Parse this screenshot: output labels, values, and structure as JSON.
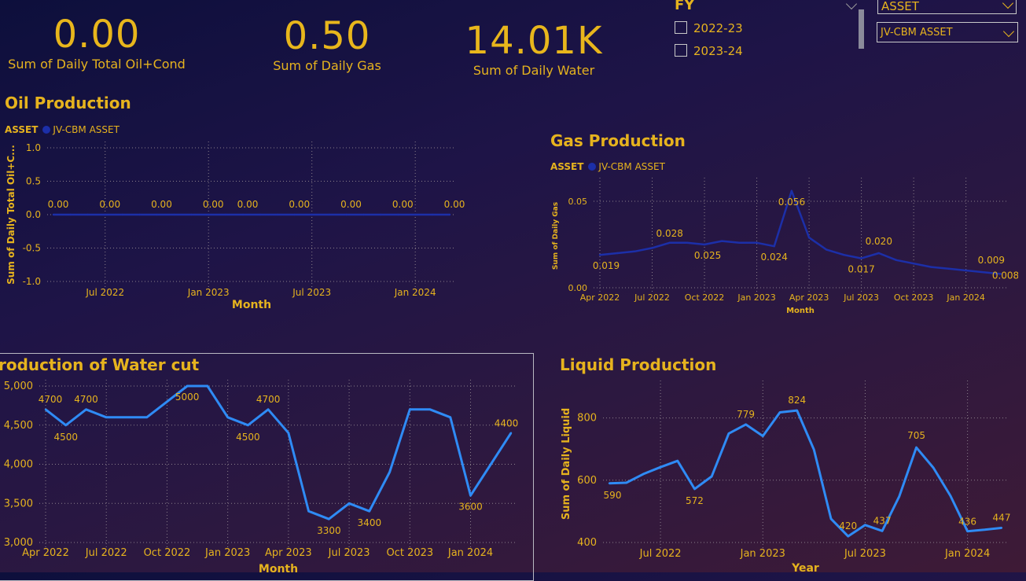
{
  "kpis": [
    {
      "value": "0.00",
      "label": "Sum of Daily Total Oil+Cond"
    },
    {
      "value": "0.50",
      "label": "Sum of Daily Gas"
    },
    {
      "value": "14.01K",
      "label": "Sum of Daily Water"
    }
  ],
  "fy_filter": {
    "title": "FY",
    "items": [
      "2022-23",
      "2023-24"
    ]
  },
  "asset_filter": {
    "header": "ASSET",
    "selected": "JV-CBM ASSET"
  },
  "colors": {
    "accent": "#e6b31e",
    "dark_series": "#1c2fa8",
    "bright_series": "#2f8bf5"
  },
  "charts": {
    "oil": {
      "title": "Oil Production",
      "legend_title": "ASSET",
      "legend_item": "JV-CBM ASSET"
    },
    "gas": {
      "title": "Gas Production",
      "legend_title": "ASSET",
      "legend_item": "JV-CBM ASSET"
    },
    "water": {
      "title": "roduction of Water cut"
    },
    "liquid": {
      "title": "Liquid Production"
    }
  },
  "chart_data": [
    {
      "id": "oil",
      "type": "line",
      "title": "Oil Production",
      "xlabel": "Month",
      "ylabel": "Sum of Daily Total Oil+C...",
      "legend": "top-left",
      "grid": true,
      "ylim": [
        -1.0,
        1.0
      ],
      "yticks": [
        "1.0",
        "0.5",
        "0.0",
        "-0.5",
        "-1.0"
      ],
      "xticks": [
        "Jul 2022",
        "Jan 2023",
        "Jul 2023",
        "Jan 2024"
      ],
      "series": [
        {
          "name": "JV-CBM ASSET",
          "values": [
            0,
            0,
            0,
            0,
            0,
            0,
            0,
            0,
            0,
            0,
            0,
            0,
            0,
            0,
            0,
            0,
            0,
            0,
            0,
            0,
            0,
            0,
            0,
            0
          ]
        }
      ],
      "data_labels": [
        "0.00",
        "0.00",
        "0.00",
        "0.00",
        "0.00",
        "0.00",
        "0.00",
        "0.00",
        "0.00"
      ]
    },
    {
      "id": "gas",
      "type": "line",
      "title": "Gas Production",
      "xlabel": "Month",
      "ylabel": "Sum of Daily Gas",
      "legend": "top-left",
      "grid": true,
      "ylim": [
        0,
        0.06
      ],
      "yticks": [
        "0.05",
        "0.00"
      ],
      "xticks": [
        "Apr 2022",
        "Jul 2022",
        "Oct 2022",
        "Jan 2023",
        "Apr 2023",
        "Jul 2023",
        "Oct 2023",
        "Jan 2024"
      ],
      "series": [
        {
          "name": "JV-CBM ASSET",
          "values": [
            0.019,
            0.02,
            0.021,
            0.023,
            0.026,
            0.026,
            0.025,
            0.027,
            0.026,
            0.026,
            0.024,
            0.056,
            0.029,
            0.022,
            0.019,
            0.017,
            0.02,
            0.016,
            0.014,
            0.012,
            0.011,
            0.01,
            0.009,
            0.008
          ]
        }
      ],
      "data_labels": [
        {
          "i": 0,
          "text": "0.019"
        },
        {
          "i": 4,
          "text": "0.028"
        },
        {
          "i": 6,
          "text": "0.025"
        },
        {
          "i": 10,
          "text": "0.024"
        },
        {
          "i": 11,
          "text": "0.056"
        },
        {
          "i": 15,
          "text": "0.017"
        },
        {
          "i": 16,
          "text": "0.020"
        },
        {
          "i": 22,
          "text": "0.009"
        },
        {
          "i": 23,
          "text": "0.008"
        }
      ]
    },
    {
      "id": "water",
      "type": "line",
      "title": "roduction of Water cut",
      "xlabel": "Month",
      "ylabel": "",
      "grid": true,
      "ylim": [
        3000,
        5000
      ],
      "yticks": [
        "5,000",
        "4,500",
        "4,000",
        "3,500",
        "3,000"
      ],
      "xticks": [
        "Apr 2022",
        "Jul 2022",
        "Oct 2022",
        "Jan 2023",
        "Apr 2023",
        "Jul 2023",
        "Oct 2023",
        "Jan 2024"
      ],
      "series": [
        {
          "name": "",
          "values": [
            4700,
            4500,
            4700,
            4600,
            4600,
            4600,
            4800,
            5000,
            5000,
            4600,
            4500,
            4700,
            4400,
            3400,
            3300,
            3500,
            3400,
            3900,
            4700,
            4700,
            4600,
            3600,
            4000,
            4400
          ]
        }
      ],
      "data_labels": [
        {
          "i": 0,
          "text": "4700"
        },
        {
          "i": 1,
          "text": "4500"
        },
        {
          "i": 2,
          "text": "4700"
        },
        {
          "i": 7,
          "text": "5000"
        },
        {
          "i": 10,
          "text": "4500"
        },
        {
          "i": 11,
          "text": "4700"
        },
        {
          "i": 14,
          "text": "3300"
        },
        {
          "i": 16,
          "text": "3400"
        },
        {
          "i": 21,
          "text": "3600"
        },
        {
          "i": 23,
          "text": "4400"
        }
      ]
    },
    {
      "id": "liquid",
      "type": "line",
      "title": "Liquid Production",
      "xlabel": "Year",
      "ylabel": "Sum of Daily Liquid",
      "grid": true,
      "ylim": [
        400,
        900
      ],
      "yticks": [
        "800",
        "600",
        "400"
      ],
      "xticks": [
        "Jul 2022",
        "Jan 2023",
        "Jul 2023",
        "Jan 2024"
      ],
      "series": [
        {
          "name": "",
          "values": [
            590,
            592,
            620,
            642,
            662,
            572,
            612,
            750,
            779,
            742,
            818,
            824,
            698,
            476,
            420,
            456,
            437,
            548,
            705,
            640,
            550,
            436,
            441,
            447
          ]
        }
      ],
      "data_labels": [
        {
          "i": 0,
          "text": "590"
        },
        {
          "i": 5,
          "text": "572"
        },
        {
          "i": 8,
          "text": "779"
        },
        {
          "i": 11,
          "text": "824"
        },
        {
          "i": 14,
          "text": "420"
        },
        {
          "i": 16,
          "text": "437"
        },
        {
          "i": 18,
          "text": "705"
        },
        {
          "i": 21,
          "text": "436"
        },
        {
          "i": 23,
          "text": "447"
        }
      ]
    }
  ]
}
